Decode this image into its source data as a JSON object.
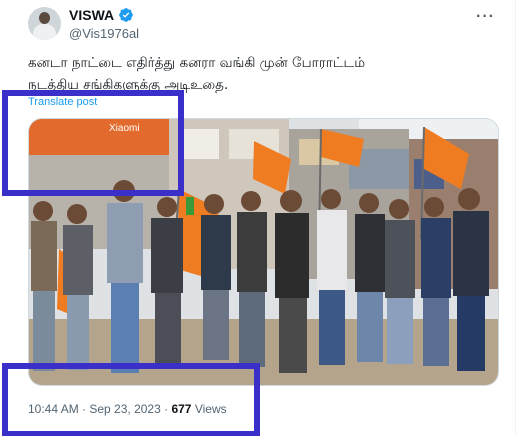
{
  "author": {
    "name": "VISWA",
    "handle": "@Vis1976al"
  },
  "more_label": "···",
  "tweet": {
    "line1": "கனடா நாட்டை எதிர்த்து கனரா வங்கி முன் போராட்டம்",
    "line2": "நடத்திய சங்கிகளுக்கு அடிஉதை.",
    "translate_label": "Translate post"
  },
  "photo": {
    "shop_sign": "Xiaomi"
  },
  "meta": {
    "time": "10:44 AM",
    "sep1": " · ",
    "date": "Sep 23, 2023",
    "sep2": " · ",
    "views_count": "677",
    "views_label": " Views"
  },
  "colors": {
    "highlight": "#3b2fc9",
    "link": "#1d9bf0",
    "secondary_text": "#536471"
  }
}
